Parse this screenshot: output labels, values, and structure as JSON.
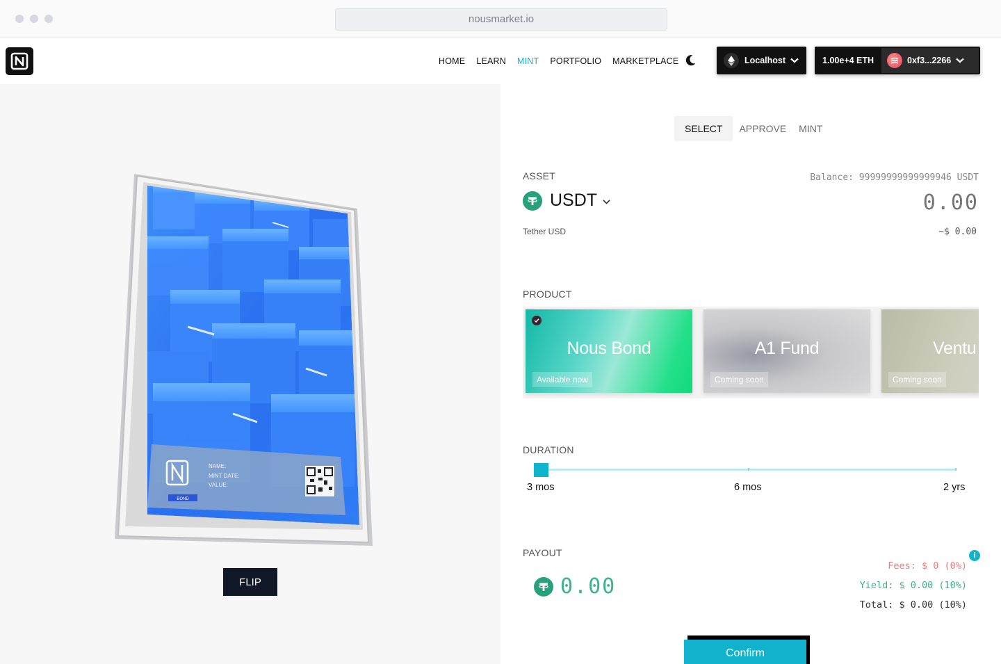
{
  "browser": {
    "url": "nousmarket.io"
  },
  "nav": {
    "items": [
      "HOME",
      "LEARN",
      "MINT",
      "PORTFOLIO",
      "MARKETPLACE"
    ],
    "active": "MINT"
  },
  "network": {
    "label": "Localhost",
    "icon": "ethereum-icon"
  },
  "account": {
    "balance": "1.00e+4 ETH",
    "address": "0xf3...2266"
  },
  "card": {
    "name_label": "NAME:",
    "mint_date_label": "MINT DATE:",
    "value_label": "VALUE:",
    "tag": "BOND",
    "flip_label": "FLIP"
  },
  "steps": [
    "SELECT",
    "APPROVE",
    "MINT"
  ],
  "active_step": "SELECT",
  "asset": {
    "section_label": "ASSET",
    "balance": "Balance: 99999999999999946 USDT",
    "symbol": "USDT",
    "name": "Tether USD",
    "amount": "0.00",
    "usd_value": "~$ 0.00"
  },
  "product": {
    "section_label": "PRODUCT",
    "items": [
      {
        "name": "Nous Bond",
        "status": "Available now",
        "selected": true
      },
      {
        "name": "A1 Fund",
        "status": "Coming soon",
        "selected": false
      },
      {
        "name": "Ventu",
        "status": "Coming soon",
        "selected": false
      }
    ]
  },
  "duration": {
    "section_label": "DURATION",
    "marks": [
      "3 mos",
      "6 mos",
      "2 yrs"
    ],
    "selected": "3 mos"
  },
  "payout": {
    "section_label": "PAYOUT",
    "amount": "0.00",
    "fees": "Fees: $ 0 (0%)",
    "yield": "Yield: $ 0.00 (10%)",
    "total": "Total: $ 0.00 (10%)"
  },
  "confirm_label": "Confirm",
  "colors": {
    "accent": "#11b3cc",
    "tether": "#26a17b",
    "fees": "#f07a7a",
    "yield": "#3db28e"
  }
}
